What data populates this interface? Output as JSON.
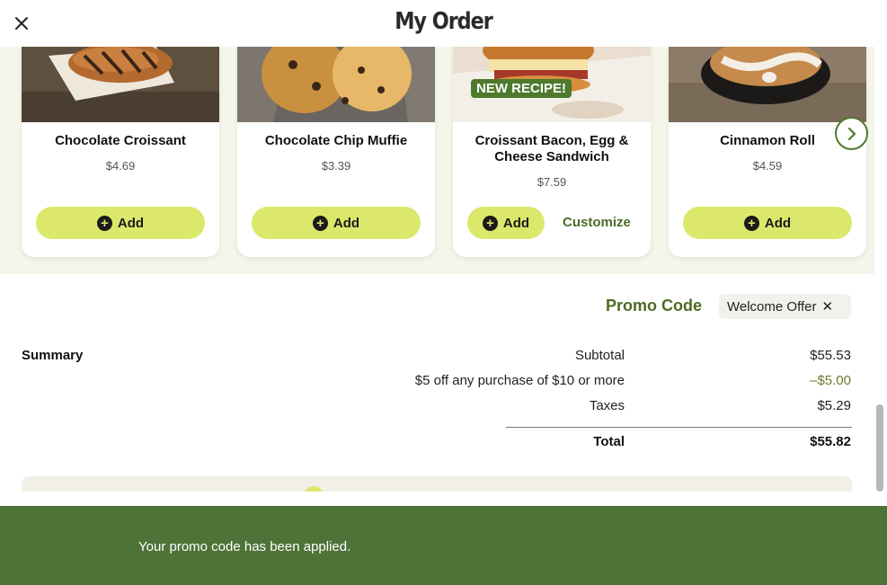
{
  "header": {
    "title": "My Order"
  },
  "recommendations": [
    {
      "name": "Chocolate Croissant",
      "price": "$4.69",
      "add_label": "Add"
    },
    {
      "name": "Chocolate Chip Muffie",
      "price": "$3.39",
      "add_label": "Add"
    },
    {
      "name": "Croissant Bacon, Egg & Cheese Sandwich",
      "price": "$7.59",
      "add_label": "Add",
      "badge": "NEW RECIPE!",
      "customize_label": "Customize"
    },
    {
      "name": "Cinnamon Roll",
      "price": "$4.59",
      "add_label": "Add"
    }
  ],
  "promo": {
    "label": "Promo Code",
    "applied_code": "Welcome Offer",
    "remove_icon": "close-icon"
  },
  "summary": {
    "title": "Summary",
    "rows": [
      {
        "label": "Subtotal",
        "value": "$55.53"
      },
      {
        "label": "$5 off any purchase of $10 or more",
        "value": "–$5.00"
      },
      {
        "label": "Taxes",
        "value": "$5.29"
      }
    ],
    "total_label": "Total",
    "total_value": "$55.82"
  },
  "toast": {
    "message": "Your promo code has been applied."
  },
  "colors": {
    "accent_lime": "#dbe86b",
    "brand_green": "#4e7339",
    "promo_text": "#4e6b23",
    "band_bg": "#f4f6ea"
  },
  "icons": [
    "close-icon",
    "chevron-right-icon",
    "plus-circle-icon"
  ]
}
